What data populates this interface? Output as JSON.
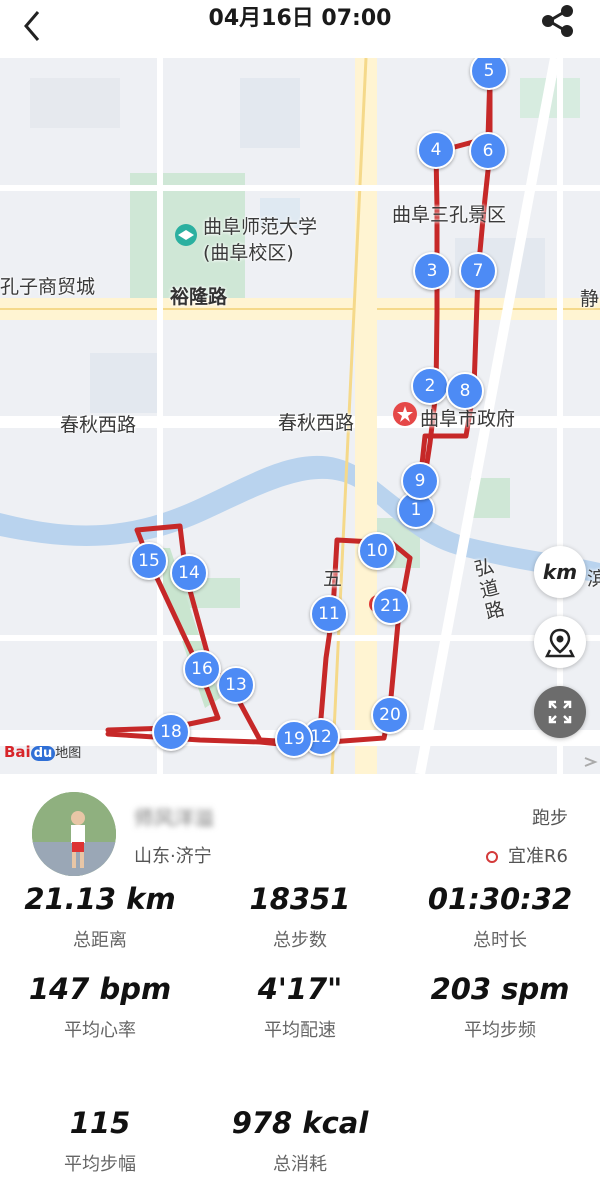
{
  "header": {
    "back_icon": "chevron-left-icon",
    "title": "04月16日 07:00",
    "share_icon": "share-icon"
  },
  "map": {
    "labels": {
      "university_1": "曲阜师范大学",
      "university_2": "(曲阜校区)",
      "scenic": "曲阜三孔景区",
      "trade_city": "孔子商贸城",
      "yulong_road": "裕隆路",
      "jing": "静",
      "chunqiu_1": "春秋西路",
      "chunqiu_2": "春秋西路",
      "gov": "曲阜市政府",
      "hongdao": "弘道路",
      "wu": "五",
      "jing2": "滨"
    },
    "markers": [
      "1",
      "2",
      "3",
      "4",
      "5",
      "6",
      "7",
      "8",
      "9",
      "10",
      "11",
      "12",
      "13",
      "14",
      "15",
      "16",
      "18",
      "19",
      "20",
      "21"
    ],
    "route_color": "#c62828",
    "marker_color": "#4d8bf5",
    "controls": {
      "unit": "km",
      "location_icon": "map-pin-icon",
      "fullscreen_icon": "fullscreen-icon"
    },
    "logo": {
      "bai": "Bai",
      "du": "du",
      "ditu": "地图"
    }
  },
  "profile": {
    "username": "师风洋溢",
    "location": "山东·济宁",
    "sport": "跑步",
    "device": "宜准R6"
  },
  "stats": [
    {
      "value": "21.13 km",
      "label": "总距离"
    },
    {
      "value": "18351",
      "label": "总步数"
    },
    {
      "value": "01:30:32",
      "label": "总时长"
    },
    {
      "value": "147 bpm",
      "label": "平均心率"
    },
    {
      "value": "4'17\"",
      "label": "平均配速"
    },
    {
      "value": "203 spm",
      "label": "平均步频"
    },
    {
      "value": "115",
      "label": "平均步幅"
    },
    {
      "value": "978 kcal",
      "label": "总消耗"
    }
  ]
}
